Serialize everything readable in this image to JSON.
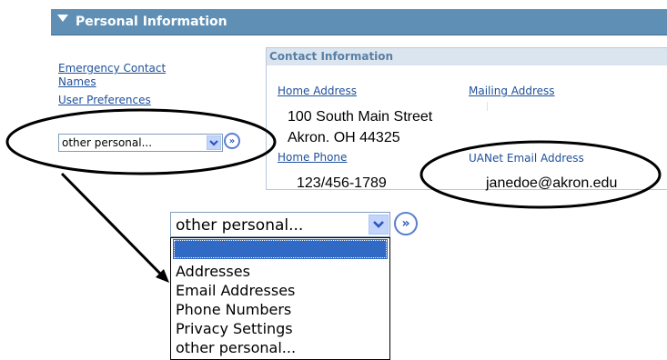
{
  "header": {
    "title": "Personal Information"
  },
  "sidebar": {
    "links": [
      "Emergency Contact",
      "Names",
      "User Preferences"
    ]
  },
  "small_select": {
    "value": "other personal..."
  },
  "contact": {
    "title": "Contact Information",
    "home_address_label": "Home Address",
    "mailing_address_label": "Mailing Address",
    "address_line1": "100 South Main Street",
    "address_line2": "Akron. OH 44325",
    "home_phone_label": "Home Phone",
    "phone": "123/456-1789",
    "email_label": "UANet Email Address",
    "email": "janedoe@akron.edu"
  },
  "big_select": {
    "value": "other personal...",
    "options": [
      "",
      "Addresses",
      "Email Addresses",
      "Phone Numbers",
      "Privacy Settings",
      "other personal..."
    ]
  },
  "icons": {
    "go": "double-chevron-right-icon",
    "dropdown": "chevron-down-icon",
    "expand": "triangle-down-icon"
  },
  "colors": {
    "header_bg": "#5f8fb5",
    "link": "#1e4f9a",
    "highlight": "#316ac5",
    "panel_header": "#dbe5ef"
  }
}
